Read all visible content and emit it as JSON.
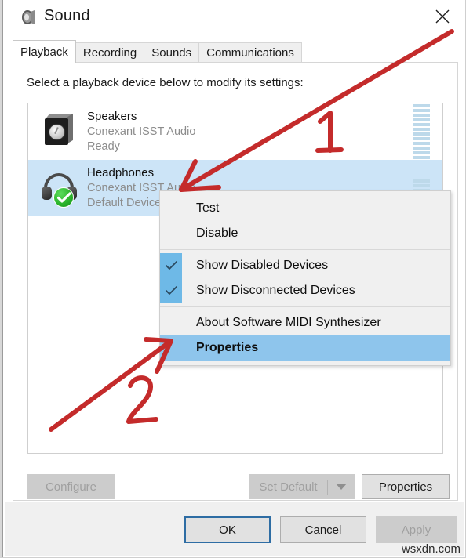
{
  "window": {
    "title": "Sound",
    "icon": "speaker-icon",
    "close_label": "✕"
  },
  "tabs": [
    {
      "label": "Playback",
      "active": true
    },
    {
      "label": "Recording",
      "active": false
    },
    {
      "label": "Sounds",
      "active": false
    },
    {
      "label": "Communications",
      "active": false
    }
  ],
  "playback": {
    "hint": "Select a playback device below to modify its settings:",
    "devices": [
      {
        "name": "Speakers",
        "driver": "Conexant ISST Audio",
        "status": "Ready",
        "icon": "speaker-icon",
        "selected": false,
        "default": false,
        "meter_segments": 12,
        "meter_active": 0
      },
      {
        "name": "Headphones",
        "driver": "Conexant ISST Audio",
        "status": "Default Device",
        "icon": "headphones-icon",
        "selected": true,
        "default": true,
        "meter_segments": 4,
        "meter_active": 0
      }
    ]
  },
  "context_menu": {
    "items": [
      {
        "label": "Test",
        "checked": false,
        "highlight": false,
        "separator_after": false
      },
      {
        "label": "Disable",
        "checked": false,
        "highlight": false,
        "separator_after": true
      },
      {
        "label": "Show Disabled Devices",
        "checked": true,
        "highlight": false,
        "separator_after": false
      },
      {
        "label": "Show Disconnected Devices",
        "checked": true,
        "highlight": false,
        "separator_after": true
      },
      {
        "label": "About Software MIDI Synthesizer",
        "checked": false,
        "highlight": false,
        "separator_after": false
      },
      {
        "label": "Properties",
        "checked": false,
        "highlight": true,
        "separator_after": false
      }
    ],
    "check_glyph": "✓"
  },
  "buttons": {
    "configure": {
      "label": "Configure",
      "enabled": false
    },
    "set_default": {
      "label": "Set Default",
      "enabled": false
    },
    "set_default_dropdown": {
      "label": "chevron-down-icon",
      "enabled": false
    },
    "properties": {
      "label": "Properties",
      "enabled": true
    },
    "ok": {
      "label": "OK",
      "enabled": true,
      "focused": true
    },
    "cancel": {
      "label": "Cancel",
      "enabled": true
    },
    "apply": {
      "label": "Apply",
      "enabled": false
    }
  },
  "annotations": [
    {
      "id": "1",
      "label": "1",
      "color": "#c42b2b",
      "points_to": "headphones-device-row"
    },
    {
      "id": "2",
      "label": "2",
      "color": "#c42b2b",
      "points_to": "context-menu-item-properties"
    }
  ],
  "watermark": "wsxdn.com",
  "colors": {
    "selection_blue": "#cce4f7",
    "menu_highlight": "#8ec5ec",
    "check_block": "#6eb9e7",
    "meter_bar": "#bdd9ea",
    "annotation_red": "#c42b2b",
    "focus_border": "#2e6da4"
  }
}
